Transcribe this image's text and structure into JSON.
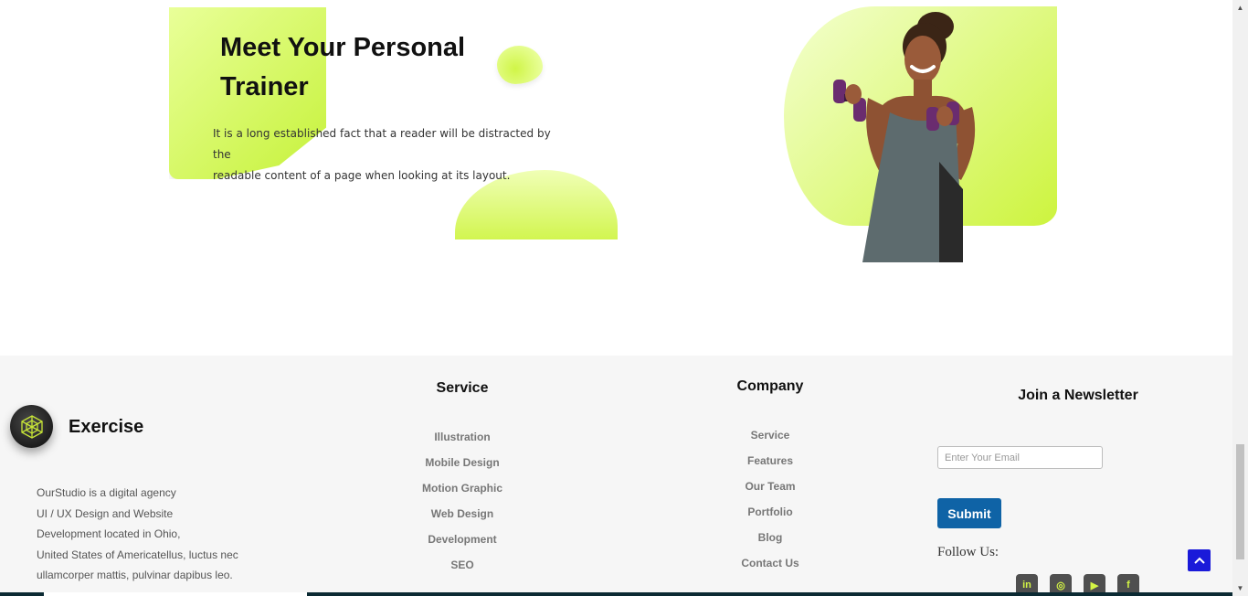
{
  "hero": {
    "title": "Meet Your Personal Trainer",
    "text_line1": "It is a long established fact that a reader will be distracted by the",
    "text_line2": "readable content of a page when looking at its layout."
  },
  "brand": {
    "name": "Exercise",
    "about_lines": [
      "OurStudio is a digital agency",
      "UI / UX Design and Website",
      "Development located in Ohio,",
      "United States of Americatellus, luctus nec",
      "ullamcorper mattis, pulvinar dapibus leo."
    ]
  },
  "service": {
    "title": "Service",
    "items": [
      "Illustration",
      "Mobile Design",
      "Motion Graphic",
      "Web Design",
      "Development",
      "SEO"
    ]
  },
  "company": {
    "title": "Company",
    "items": [
      "Service",
      "Features",
      "Our Team",
      "Portfolio",
      "Blog",
      "Contact Us"
    ]
  },
  "newsletter": {
    "title": "Join a Newsletter",
    "email_placeholder": "Enter Your Email",
    "email_value": "",
    "submit_label": "Submit",
    "follow_label": "Follow Us:"
  },
  "socials": [
    {
      "icon": "linkedin-icon",
      "glyph": "in"
    },
    {
      "icon": "instagram-icon",
      "glyph": "◎"
    },
    {
      "icon": "youtube-icon",
      "glyph": "▶"
    },
    {
      "icon": "facebook-icon",
      "glyph": "f"
    }
  ],
  "colors": {
    "accent_lime": "#c6f23a",
    "button_blue": "#0f63a6",
    "scroll_top_blue": "#1a1ad9",
    "footer_bg": "#f6f6f6"
  }
}
